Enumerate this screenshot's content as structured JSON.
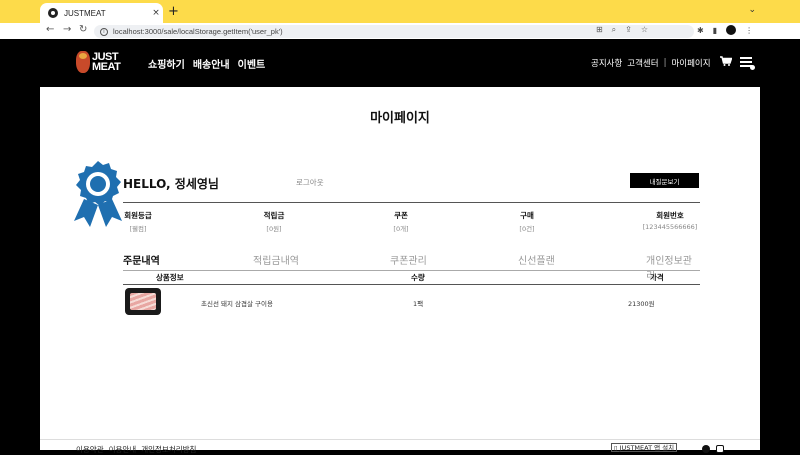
{
  "browser": {
    "tab_title": "JUSTMEAT",
    "tab_close": "×",
    "new_tab": "+",
    "tab_menu": "⌄",
    "url": "localhost:3000/sale/localStorage.getItem('user_pk')",
    "nav_icons": [
      "back-icon",
      "forward-icon",
      "reload-icon"
    ]
  },
  "header": {
    "logo_line1": "JUST",
    "logo_line2": "MEAT",
    "nav": [
      "쇼핑하기",
      "배송안내",
      "이벤트"
    ],
    "right_nav": [
      "공지사항",
      "고객센터",
      "|",
      "마이페이지"
    ]
  },
  "page": {
    "title": "마이페이지",
    "greeting": "HELLO, 정세영님",
    "logout": "로그아웃",
    "inquiry_button": "내질문보기",
    "stats": [
      {
        "label": "회원등급",
        "value": "[웰컴]"
      },
      {
        "label": "적립금",
        "value": "[0원]"
      },
      {
        "label": "쿠폰",
        "value": "[0개]"
      },
      {
        "label": "구매",
        "value": "[0건]"
      },
      {
        "label": "회원번호",
        "value": "[123445566666]"
      }
    ],
    "tabs": [
      "주문내역",
      "적립금내역",
      "쿠폰관리",
      "신선플랜",
      "개인정보관리"
    ],
    "active_tab": "주문내역",
    "table_headers": [
      "상품정보",
      "수량",
      "가격"
    ],
    "orders": [
      {
        "name": "초신선 돼지 삼겹살 구이용",
        "qty": "1팩",
        "price": "21300원"
      }
    ]
  },
  "footer": {
    "links": [
      "이용약관",
      "이용안내",
      "개인정보처리방침"
    ],
    "app_button": "▯ JUSTMEAT 앱 설치"
  },
  "colors": {
    "browser_chrome": "#fddb4a",
    "header_bg": "#000000",
    "badge": "#1f6fb0"
  }
}
